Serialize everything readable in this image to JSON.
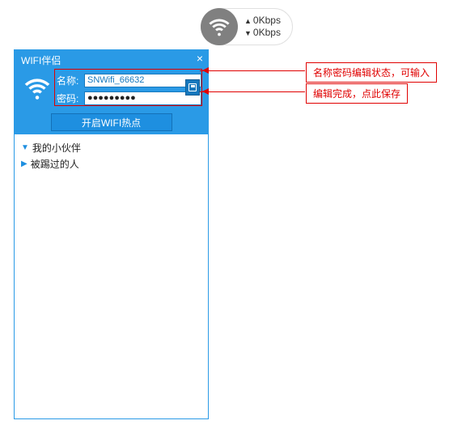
{
  "speed": {
    "up": "0Kbps",
    "down": "0Kbps"
  },
  "app": {
    "title": "WIFI伴侣",
    "name_label": "名称:",
    "password_label": "密码:",
    "ssid_value": "SNWifi_66632",
    "password_value": "●●●●●●●●●",
    "save_icon_name": "save-icon",
    "start_button": "开启WIFI热点"
  },
  "expand": {
    "partners": "我的小伙伴",
    "kicked": "被踢过的人"
  },
  "callouts": {
    "c1": "名称密码编辑状态，可输入",
    "c2": "编辑完成，点此保存"
  }
}
